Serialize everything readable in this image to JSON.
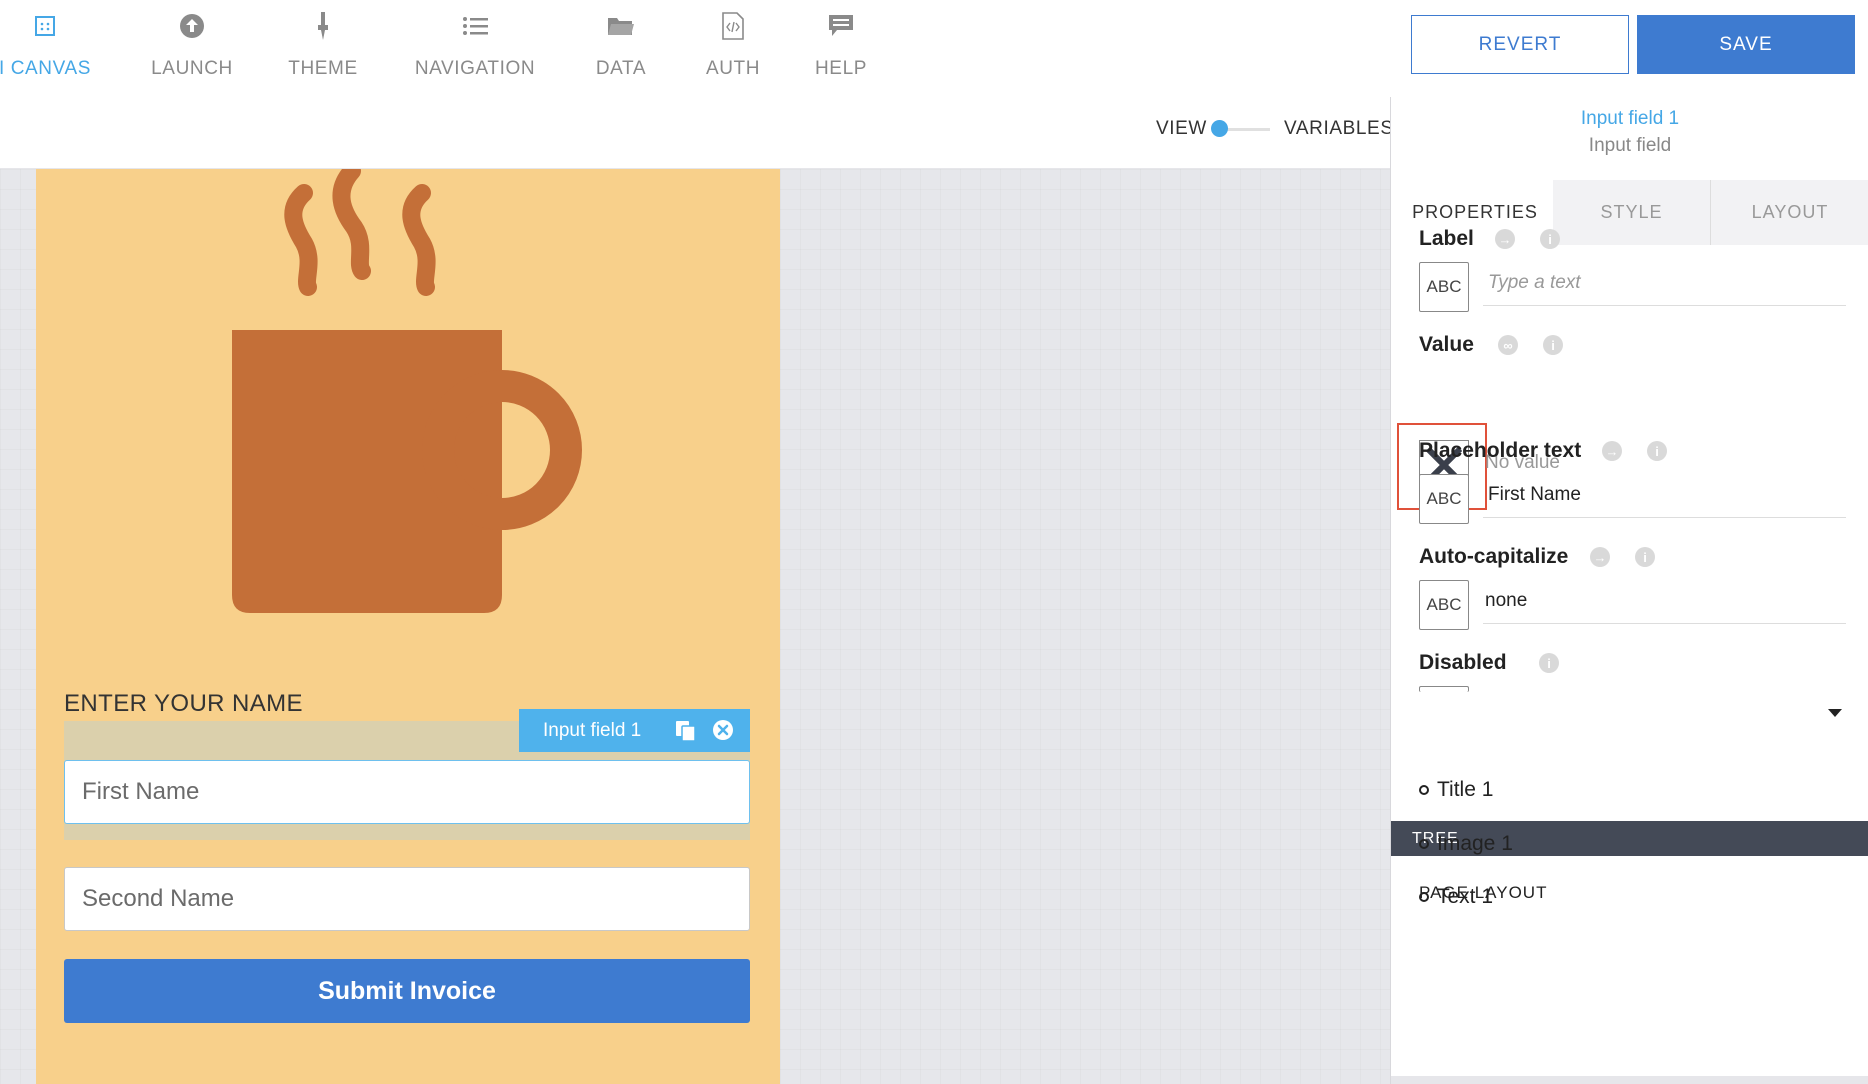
{
  "nav": {
    "items": [
      {
        "label": "I CANVAS",
        "icon": "canvas-icon",
        "active": true
      },
      {
        "label": "LAUNCH",
        "icon": "upload-icon"
      },
      {
        "label": "THEME",
        "icon": "brush-icon"
      },
      {
        "label": "NAVIGATION",
        "icon": "list-icon"
      },
      {
        "label": "DATA",
        "icon": "folder-icon"
      },
      {
        "label": "AUTH",
        "icon": "code-file-icon"
      },
      {
        "label": "HELP",
        "icon": "chat-icon"
      }
    ],
    "revert_label": "REVERT",
    "save_label": "SAVE"
  },
  "subbar": {
    "view_label": "VIEW",
    "variables_label": "VARIABLES"
  },
  "canvas": {
    "section_label": "ENTER YOUR NAME",
    "chip_label": "Input field 1",
    "first_name_placeholder": "First Name",
    "second_name_placeholder": "Second Name",
    "submit_label": "Submit Invoice"
  },
  "panel": {
    "title": "Input field 1",
    "subtitle": "Input field",
    "tabs": [
      "PROPERTIES",
      "STYLE",
      "LAYOUT"
    ],
    "abc_glyph": "ABC",
    "label": {
      "title": "Label",
      "placeholder": "Type a text"
    },
    "value": {
      "title": "Value",
      "text": "No value"
    },
    "placeholder_text": {
      "title": "Placeholder text",
      "value": "First Name"
    },
    "autocapitalize": {
      "title": "Auto-capitalize",
      "value": "none"
    },
    "disabled": {
      "title": "Disabled"
    }
  },
  "tree": {
    "bar_label": "TREE",
    "section": "PAGE LAYOUT",
    "items": [
      "Title 1",
      "Image 1",
      "Text 1"
    ]
  },
  "colors": {
    "accent_blue": "#3e7bd0",
    "active_blue": "#45a7e6",
    "phone_bg": "#f8d08b",
    "mug": "#c46f38",
    "highlight_red": "#e0513a"
  }
}
